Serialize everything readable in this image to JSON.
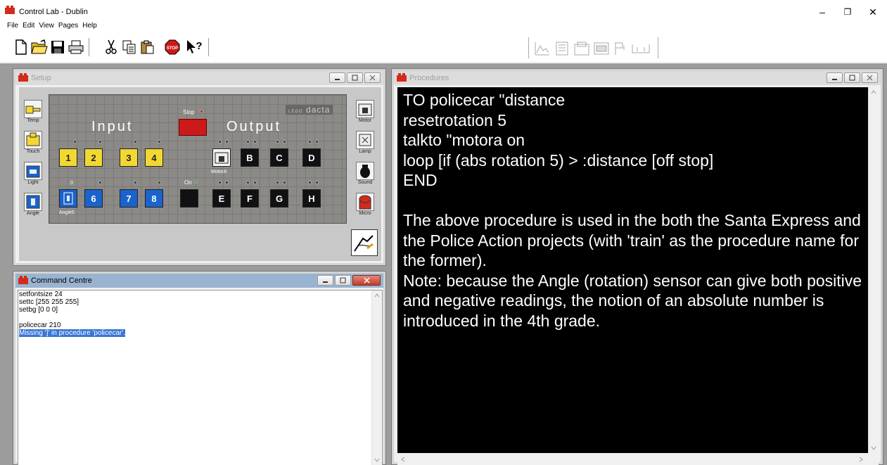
{
  "app": {
    "title": "Control Lab - Dublin",
    "window_controls": {
      "minimize": "–",
      "restore": "❐",
      "close": "✕"
    }
  },
  "menu": [
    "File",
    "Edit",
    "View",
    "Pages",
    "Help"
  ],
  "toolbar": {
    "buttons": [
      "new-file",
      "open-folder",
      "save-disk",
      "print",
      "cut-scissors",
      "copy",
      "paste",
      "stop-sign",
      "context-help"
    ],
    "stop_label": "STOP",
    "help_label": "?"
  },
  "windows": {
    "setup": {
      "title": "Setup",
      "input_label": "Input",
      "output_label": "Output",
      "stop_label": "Stop",
      "on_label": "On",
      "brand": "dacta",
      "brand_small": "LEGO",
      "left_sensors": [
        "Temp",
        "Touch",
        "Light",
        "Angle"
      ],
      "right_effectors": [
        "Motor",
        "Lamp",
        "Sound",
        "Micro"
      ],
      "input_top": [
        "1",
        "2",
        "3",
        "4"
      ],
      "input_bottom": [
        "6",
        "7",
        "8"
      ],
      "input_bottom_value": "0",
      "input_bottom_name": "Angle5",
      "output_top": [
        "B",
        "C",
        "D"
      ],
      "output_bottom": [
        "E",
        "F",
        "G",
        "H"
      ],
      "output_top_name": "MotorA"
    },
    "command_centre": {
      "title": "Command Centre",
      "lines": [
        "setfontsize 24",
        "settc [255 255 255]",
        "setbg [0 0 0]",
        "",
        "policecar 210"
      ],
      "error_line": "Missing ']' in procedure 'policecar'."
    },
    "procedures": {
      "title": "Procedures",
      "text": "TO policecar \"distance\nresetrotation 5\ntalkto \"motora on\nloop [if (abs rotation 5) > :distance [off stop]\nEND\n\nThe above procedure is used in the both the Santa Express and the Police Action projects (with 'train' as the procedure name for the former).\nNote: because the Angle (rotation) sensor can give both positive and negative readings, the notion of an absolute number is introduced in the 4th grade."
    }
  },
  "colors": {
    "active_title": "#99b4d1",
    "stop_red": "#cc1a1a",
    "input_yellow": "#f2d832",
    "input_blue": "#1b63cc",
    "selection": "#3875d7"
  }
}
